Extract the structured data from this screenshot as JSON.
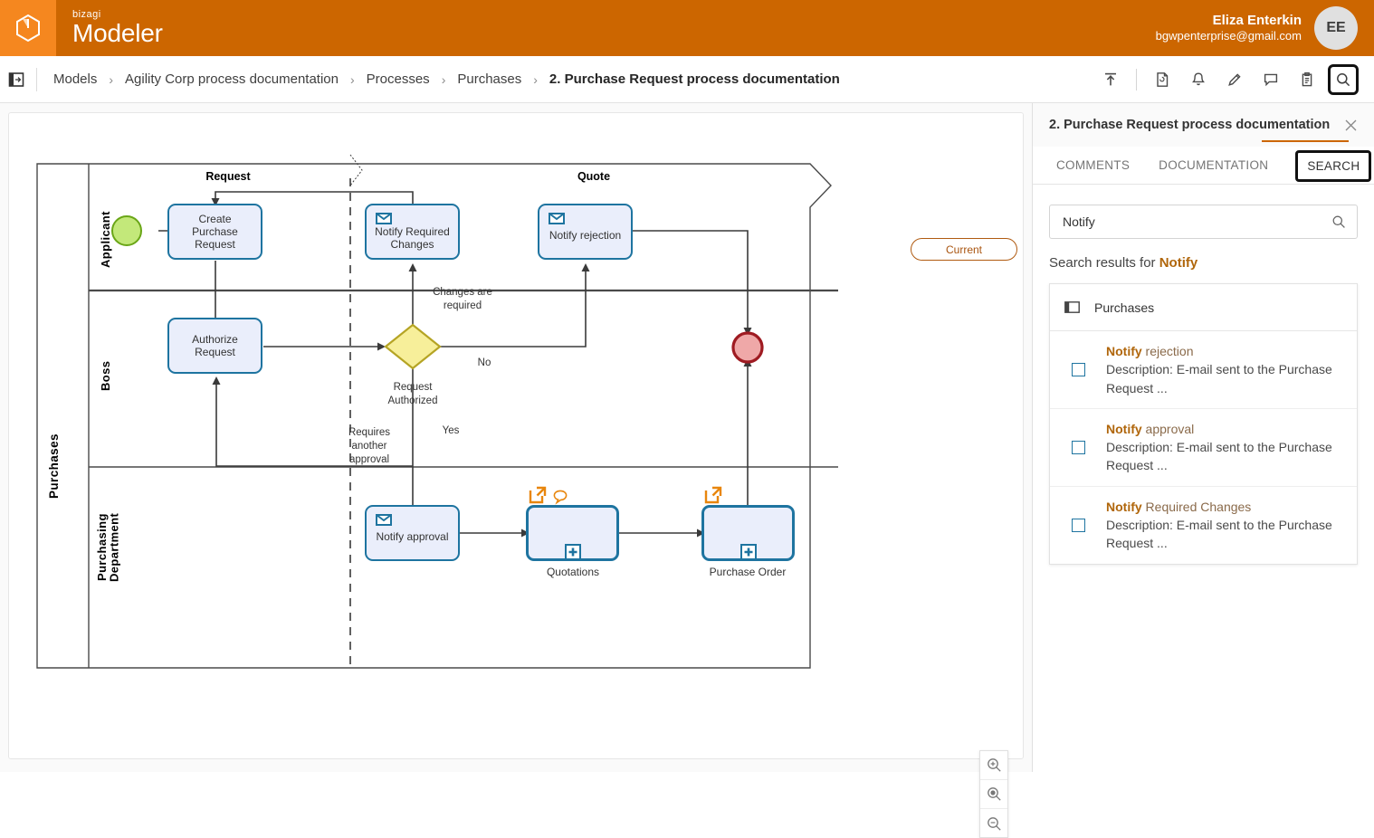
{
  "brand": {
    "sub": "bizagi",
    "name": "Modeler",
    "logo_icon": "cube-logo-icon",
    "bar_color": "#cc6600",
    "tile_color": "#f5871f"
  },
  "user": {
    "name": "Eliza Enterkin",
    "email": "bgwpenterprise@gmail.com",
    "initials": "EE"
  },
  "breadcrumb": {
    "panel_toggle_icon": "panel-toggle-icon",
    "separator": "›",
    "items": [
      {
        "label": "Models"
      },
      {
        "label": "Agility Corp process documentation"
      },
      {
        "label": "Processes"
      },
      {
        "label": "Purchases"
      },
      {
        "label": "2. Purchase Request process documentation"
      }
    ]
  },
  "toolbar": {
    "items": [
      {
        "name": "publish-icon",
        "title": "Publish"
      },
      {
        "name": "document-icon",
        "title": "Document"
      },
      {
        "name": "bell-icon",
        "title": "Notifications"
      },
      {
        "name": "pencil-icon",
        "title": "Edit"
      },
      {
        "name": "comment-icon",
        "title": "Comments"
      },
      {
        "name": "clipboard-icon",
        "title": "Clipboard"
      },
      {
        "name": "search-icon",
        "title": "Search"
      }
    ]
  },
  "canvas": {
    "current_badge": "Current",
    "zoom_controls": [
      {
        "name": "zoom-in-button",
        "glyph": "+"
      },
      {
        "name": "zoom-fit-button",
        "glyph": "●"
      },
      {
        "name": "zoom-out-button",
        "glyph": "−"
      }
    ]
  },
  "diagram": {
    "pool": "Purchases",
    "lanes": [
      "Applicant",
      "Boss",
      "Purchasing\nDepartment"
    ],
    "lane_applicant": "Applicant",
    "lane_boss": "Boss",
    "lane_purchasing": "Purchasing Department",
    "phases": [
      "Request",
      "Quote"
    ],
    "phase_request": "Request",
    "phase_quote": "Quote",
    "tasks": {
      "create_purchase_request": "Create\nPurchase\nRequest",
      "create_l1": "Create",
      "create_l2": "Purchase",
      "create_l3": "Request",
      "notify_required_changes_l1": "Notify Required",
      "notify_required_changes_l2": "Changes",
      "notify_rejection": "Notify rejection",
      "authorize_request_l1": "Authorize",
      "authorize_request_l2": "Request",
      "notify_approval": "Notify approval"
    },
    "subprocesses": {
      "quotations": "Quotations",
      "purchase_order": "Purchase Order"
    },
    "gateway_label_l1": "Request",
    "gateway_label_l2": "Authorized",
    "edge_labels": {
      "changes_required_l1": "Changes are",
      "changes_required_l2": "required",
      "no": "No",
      "yes": "Yes",
      "requires_l1": "Requires",
      "requires_l2": "another",
      "requires_l3": "approval"
    },
    "colors": {
      "task_fill": "#eaeefb",
      "task_stroke": "#1e74a0",
      "start_event": "#b6e56a",
      "end_event": "#eda0a0",
      "end_event_stroke": "#9f1b22",
      "gateway_fill": "#f5f0a0",
      "gateway_stroke": "#a89a22",
      "marker_orange": "#e8860d"
    }
  },
  "side_panel": {
    "title": "2. Purchase Request process documentation",
    "close_icon": "close-icon",
    "tabs": [
      {
        "label": "COMMENTS",
        "active": false
      },
      {
        "label": "DOCUMENTATION",
        "active": false
      },
      {
        "label": "SEARCH",
        "active": true
      }
    ],
    "search": {
      "value": "Notify",
      "placeholder": "Search",
      "icon": "search-icon",
      "results_prefix": "Search results for ",
      "results_term": "Notify"
    },
    "results_group": {
      "icon": "pool-icon",
      "label": "Purchases",
      "items": [
        {
          "highlight": "Notify",
          "rest": " rejection",
          "description": "Description: E-mail sent to the Purchase Request ...",
          "checkbox_name": "result-checkbox"
        },
        {
          "highlight": "Notify",
          "rest": " approval",
          "description": "Description: E-mail sent to the Purchase Request ...",
          "checkbox_name": "result-checkbox"
        },
        {
          "highlight": "Notify",
          "rest": " Required Changes",
          "description": "Description: E-mail sent to the Purchase Request ...",
          "checkbox_name": "result-checkbox"
        }
      ]
    }
  }
}
